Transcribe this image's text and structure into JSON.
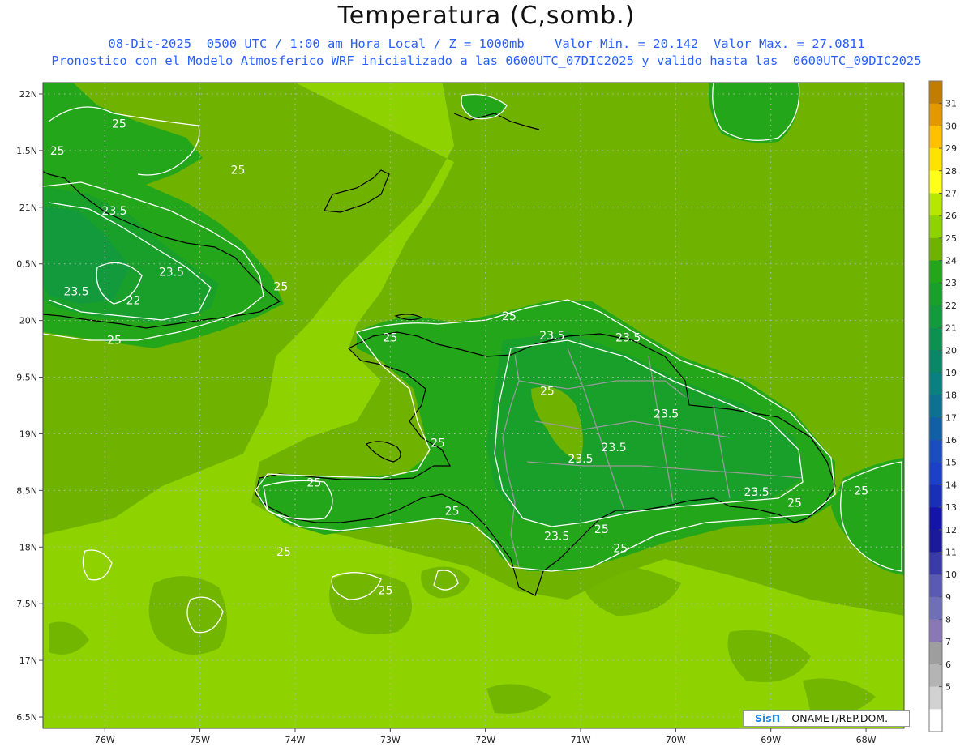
{
  "header": {
    "title": "Temperatura (C,somb.)",
    "subtitle_line1": "08-Dic-2025  0500 UTC / 1:00 am Hora Local / Z = 1000mb    Valor Min. = 20.142  Valor Max. = 27.0811",
    "subtitle_line2": "Pronostico con el Modelo Atmosferico WRF inicializado a las 0600UTC_07DIC2025 y valido hasta las  0600UTC_09DIC2025"
  },
  "credit": {
    "brand": "SisΠ",
    "text": " – ONAMET/REP.DOM."
  },
  "map": {
    "lon_range": [
      -76.65,
      -67.6
    ],
    "lat_range": [
      16.4,
      22.1
    ],
    "lon_ticks": [
      "76W",
      "75W",
      "74W",
      "73W",
      "72W",
      "71W",
      "70W",
      "69W",
      "68W"
    ],
    "lat_ticks": [
      "22N",
      "1.5N",
      "21N",
      "0.5N",
      "20N",
      "9.5N",
      "19N",
      "8.5N",
      "18N",
      "7.5N",
      "17N",
      "6.5N"
    ],
    "contour_labels": [
      {
        "text": "25",
        "lon": -75.85,
        "lat": 21.74
      },
      {
        "text": "25",
        "lon": -76.5,
        "lat": 21.5
      },
      {
        "text": "25",
        "lon": -74.6,
        "lat": 21.33
      },
      {
        "text": "23.5",
        "lon": -75.9,
        "lat": 20.97
      },
      {
        "text": "23.5",
        "lon": -75.3,
        "lat": 20.43
      },
      {
        "text": "23.5",
        "lon": -76.3,
        "lat": 20.26
      },
      {
        "text": "22",
        "lon": -75.7,
        "lat": 20.18
      },
      {
        "text": "25",
        "lon": -74.15,
        "lat": 20.3
      },
      {
        "text": "25",
        "lon": -75.9,
        "lat": 19.83
      },
      {
        "text": "25",
        "lon": -71.75,
        "lat": 20.04
      },
      {
        "text": "25",
        "lon": -73.0,
        "lat": 19.85
      },
      {
        "text": "23.5",
        "lon": -71.3,
        "lat": 19.87
      },
      {
        "text": "23.5",
        "lon": -70.5,
        "lat": 19.85
      },
      {
        "text": "25",
        "lon": -71.35,
        "lat": 19.38
      },
      {
        "text": "23.5",
        "lon": -70.1,
        "lat": 19.18
      },
      {
        "text": "25",
        "lon": -72.5,
        "lat": 18.92
      },
      {
        "text": "23.5",
        "lon": -70.65,
        "lat": 18.88
      },
      {
        "text": "23.5",
        "lon": -71.0,
        "lat": 18.78
      },
      {
        "text": "25",
        "lon": -73.8,
        "lat": 18.57
      },
      {
        "text": "23.5",
        "lon": -69.15,
        "lat": 18.49
      },
      {
        "text": "25",
        "lon": -68.05,
        "lat": 18.5
      },
      {
        "text": "25",
        "lon": -68.75,
        "lat": 18.39
      },
      {
        "text": "25",
        "lon": -72.35,
        "lat": 18.32
      },
      {
        "text": "23.5",
        "lon": -71.25,
        "lat": 18.1
      },
      {
        "text": "25",
        "lon": -70.78,
        "lat": 18.16
      },
      {
        "text": "25",
        "lon": -70.58,
        "lat": 17.99
      },
      {
        "text": "25",
        "lon": -74.12,
        "lat": 17.96
      },
      {
        "text": "25",
        "lon": -73.05,
        "lat": 17.62
      }
    ]
  },
  "colorbar": {
    "labels": [
      "31",
      "30",
      "29",
      "28",
      "27",
      "26",
      "25",
      "24",
      "23",
      "22",
      "21",
      "20",
      "19",
      "18",
      "17",
      "16",
      "15",
      "14",
      "13",
      "12",
      "11",
      "10",
      "9",
      "8",
      "7",
      "6",
      "5"
    ],
    "colors": [
      "#c07d00",
      "#e39800",
      "#ffc000",
      "#ffe300",
      "#ffff1a",
      "#b7e600",
      "#8ed200",
      "#6fb300",
      "#24a61a",
      "#18a02a",
      "#129a3d",
      "#0c9150",
      "#0a8766",
      "#0a8080",
      "#0d7291",
      "#1160a6",
      "#1a4ec0",
      "#1d40c8",
      "#1a2fb8",
      "#1414a8",
      "#1a1a9a",
      "#3a3aa8",
      "#5a5ab2",
      "#6f6fb8",
      "#8878b4",
      "#9e9e9e",
      "#b4b4b4",
      "#d2d2d2",
      "#ffffff"
    ]
  }
}
